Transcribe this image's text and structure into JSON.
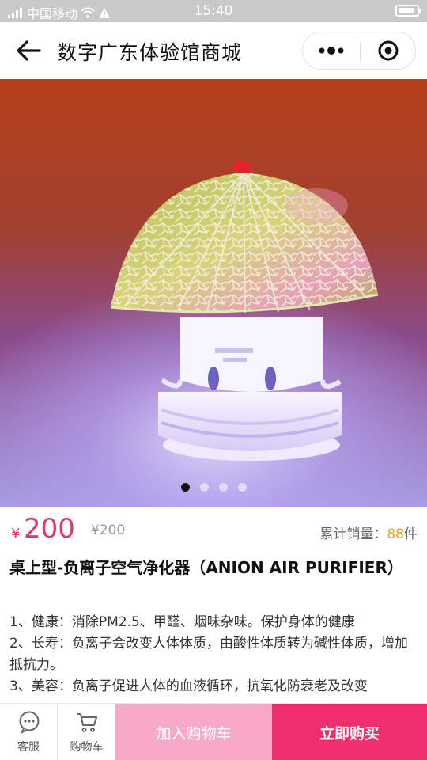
{
  "status_bar": {
    "carrier": "中国移动",
    "time": "15:40",
    "signal_icon": "signal-icon",
    "wifi_icon": "wifi-icon",
    "alert_icon": "warning-icon",
    "battery_icon": "battery-icon"
  },
  "header": {
    "title": "数字广东体验馆商城",
    "back_icon": "back-arrow-icon",
    "more_icon": "more-dots-icon",
    "close_icon": "target-circle-icon"
  },
  "gallery": {
    "image_label": "mushroom-lamp-air-purifier",
    "slide_count": 4,
    "active_index": 0
  },
  "price": {
    "currency": "¥",
    "current": "200",
    "original": "¥200",
    "sales_label": "累计销量：",
    "sales_count": "88",
    "sales_unit": "件"
  },
  "product": {
    "title": "桌上型-负离子空气净化器（ANION AIR PURIFIER）",
    "description": [
      "1、健康：消除PM2.5、甲醛、烟味杂味。保护身体的健康",
      "2、长寿：负离子会改变人体体质，由酸性体质转为碱性体质，增加抵抗力。",
      "3、美容：负离子促进人体的血液循环，抗氧化防衰老及改变"
    ]
  },
  "bottom_bar": {
    "service_label": "客服",
    "cart_label": "购物车",
    "add_cart_label": "加入购物车",
    "buy_now_label": "立即购买"
  },
  "colors": {
    "accent": "#e4386a",
    "buy_now": "#ee2f6b",
    "add_cart": "#f7a9c7",
    "sales_number": "#f0a020",
    "status_bar": "#c9c9c9"
  }
}
